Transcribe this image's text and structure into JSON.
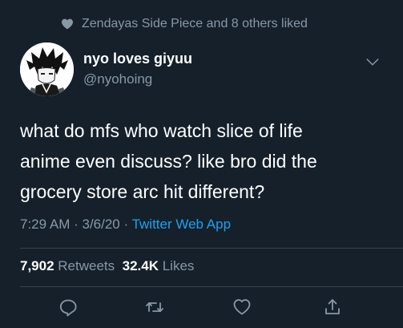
{
  "social_context": {
    "text": "Zendayas Side Piece and 8 others liked",
    "icon": "heart-icon"
  },
  "author": {
    "name": "nyo loves giyuu",
    "handle": "@nyohoing"
  },
  "tweet": {
    "line1": "what do mfs who watch slice of life",
    "line2": "anime even discuss? like bro did the",
    "line3": "grocery store arc hit different?"
  },
  "meta": {
    "time": "7:29 AM",
    "sep1": " · ",
    "date": "3/6/20",
    "sep2": " · ",
    "source": "Twitter Web App"
  },
  "stats": {
    "retweets_count": "7,902",
    "retweets_label": "Retweets",
    "likes_count": "32.4K",
    "likes_label": "Likes"
  },
  "actions": [
    "reply-icon",
    "retweet-icon",
    "like-icon",
    "share-icon"
  ],
  "colors": {
    "background": "#15202b",
    "text": "#ffffff",
    "secondary": "#8899a6",
    "link": "#1da1f2",
    "divider": "#38444d"
  }
}
